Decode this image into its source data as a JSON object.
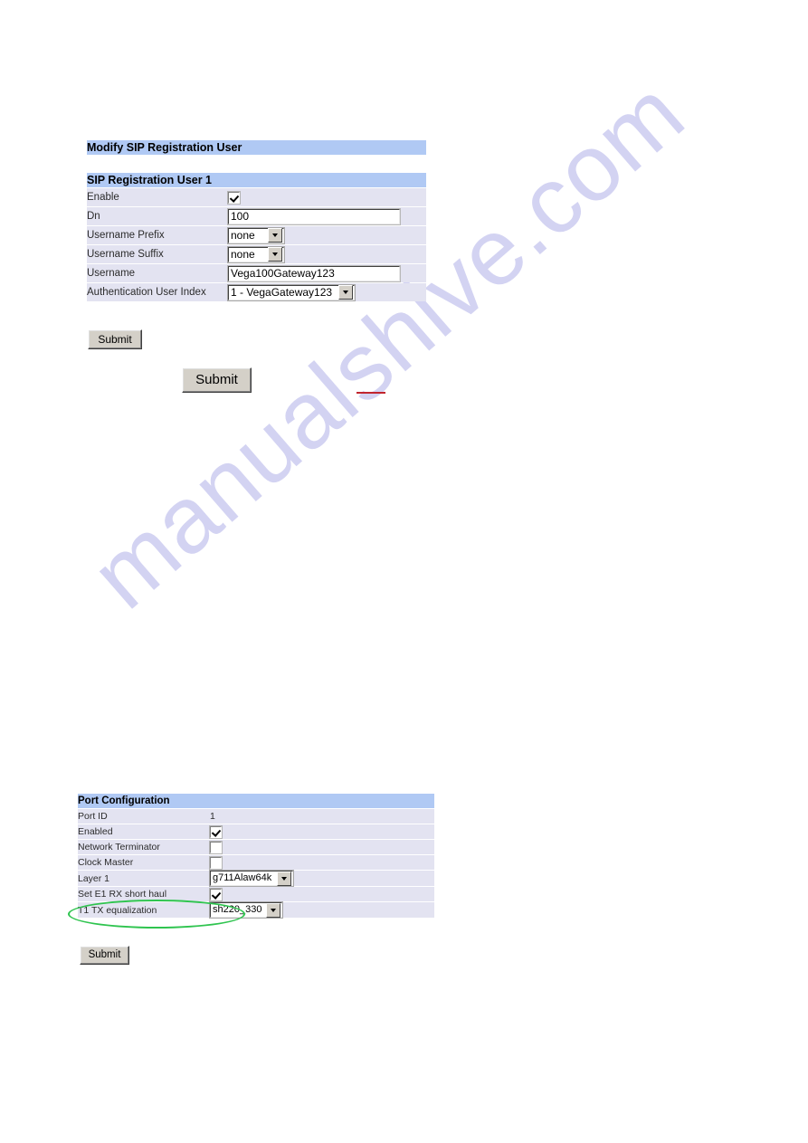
{
  "watermark": {
    "text": "manualshive.com",
    "color": "#d3d3f2"
  },
  "annotations": {
    "red_underline": {
      "color": "#c1252e"
    },
    "green_ellipse": {
      "color": "#2fc44f",
      "targets": "Set E1 RX short haul"
    }
  },
  "colors": {
    "title_bar": "#b0c9f4",
    "row_background": "#e3e3f1",
    "button_face": "#d4d0c8"
  },
  "sip_section": {
    "page_title": "Modify SIP Registration User",
    "table_title": "SIP Registration User 1",
    "rows": [
      {
        "label": "Enable",
        "type": "checkbox",
        "checked": true
      },
      {
        "label": "Dn",
        "type": "text",
        "value": "100"
      },
      {
        "label": "Username Prefix",
        "type": "select",
        "value": "none"
      },
      {
        "label": "Username Suffix",
        "type": "select",
        "value": "none"
      },
      {
        "label": "Username",
        "type": "text",
        "value": "Vega100Gateway123"
      },
      {
        "label": "Authentication User Index",
        "type": "select",
        "value": "1 - VegaGateway123"
      }
    ],
    "submit_label": "Submit"
  },
  "big_submit": {
    "label": "Submit"
  },
  "port_section": {
    "table_title": "Port Configuration",
    "rows": [
      {
        "label": "Port ID",
        "type": "static",
        "value": "1"
      },
      {
        "label": "Enabled",
        "type": "checkbox",
        "checked": true
      },
      {
        "label": "Network Terminator",
        "type": "checkbox",
        "checked": false
      },
      {
        "label": "Clock Master",
        "type": "checkbox",
        "checked": false
      },
      {
        "label": "Layer 1",
        "type": "select",
        "value": "g711Alaw64k"
      },
      {
        "label": "Set E1 RX short haul",
        "type": "checkbox",
        "checked": true
      },
      {
        "label": "T1 TX equalization",
        "type": "select",
        "value": "sh220_330"
      }
    ],
    "submit_label": "Submit"
  }
}
